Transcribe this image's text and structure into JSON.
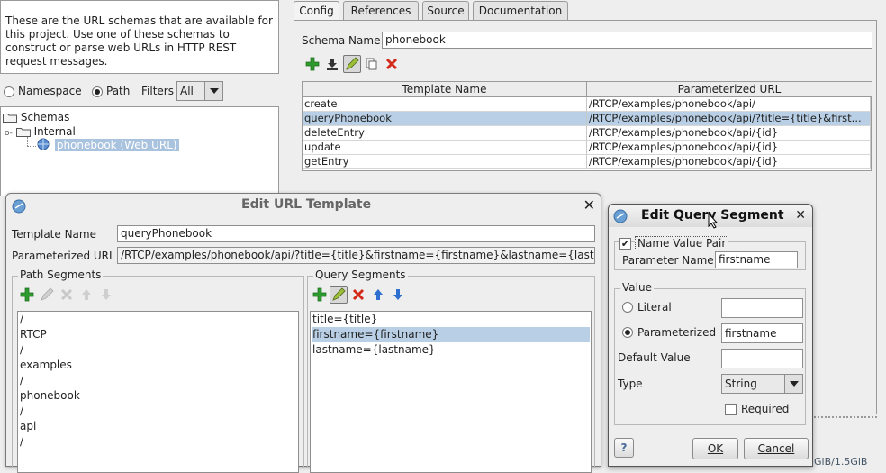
{
  "left_panel": {
    "description": "These are the URL schemas that are available for this project. Use one of these schemas to construct or parse web URLs in HTTP REST request messages.",
    "radio_namespace": "Namespace",
    "radio_path": "Path",
    "filters_label": "Filters",
    "filters_value": "All",
    "tree": {
      "root": "Schemas",
      "child": "Internal",
      "leaf": "phonebook (Web URL)"
    }
  },
  "right_panel": {
    "tabs": [
      "Config",
      "References",
      "Source",
      "Documentation"
    ],
    "schema_name_label": "Schema Name",
    "schema_name_value": "phonebook",
    "table": {
      "headers": [
        "Template Name",
        "Parameterized URL"
      ],
      "rows": [
        [
          "create",
          "/RTCP/examples/phonebook/api/"
        ],
        [
          "queryPhonebook",
          "/RTCP/examples/phonebook/api/?title={title}&first..."
        ],
        [
          "deleteEntry",
          "/RTCP/examples/phonebook/api/{id}"
        ],
        [
          "update",
          "/RTCP/examples/phonebook/api/{id}"
        ],
        [
          "getEntry",
          "/RTCP/examples/phonebook/api/{id}"
        ]
      ]
    }
  },
  "edit_url_dialog": {
    "title": "Edit URL Template",
    "template_name_label": "Template Name",
    "template_name_value": "queryPhonebook",
    "param_url_label": "Parameterized URL",
    "param_url_value": "/RTCP/examples/phonebook/api/?title={title}&firstname={firstname}&lastname={lastname}",
    "path_segments_label": "Path Segments",
    "path_segments": [
      "/",
      "RTCP",
      "/",
      "examples",
      "/",
      "phonebook",
      "/",
      "api",
      "/"
    ],
    "query_segments_label": "Query Segments",
    "query_segments": [
      "title={title}",
      "firstname={firstname}",
      "lastname={lastname}"
    ]
  },
  "edit_query_dialog": {
    "title": "Edit Query Segment",
    "name_value_pair_label": "Name Value Pair",
    "parameter_name_label": "Parameter Name",
    "parameter_name_value": "firstname",
    "value_group_label": "Value",
    "literal_label": "Literal",
    "literal_value": "",
    "parameterized_label": "Parameterized",
    "parameterized_value": "firstname",
    "default_value_label": "Default Value",
    "default_value": "",
    "type_label": "Type",
    "type_value": "String",
    "required_label": "Required",
    "help_glyph": "?",
    "ok_label": "OK",
    "cancel_label": "Cancel"
  },
  "status_bar": {
    "memory_text": "GiB/1.5GiB"
  },
  "colors": {
    "selection": "#b8cfe5",
    "add_icon": "#2e9b2e",
    "delete_icon": "#d42a1a",
    "arrow_icon": "#2f6fd0"
  }
}
